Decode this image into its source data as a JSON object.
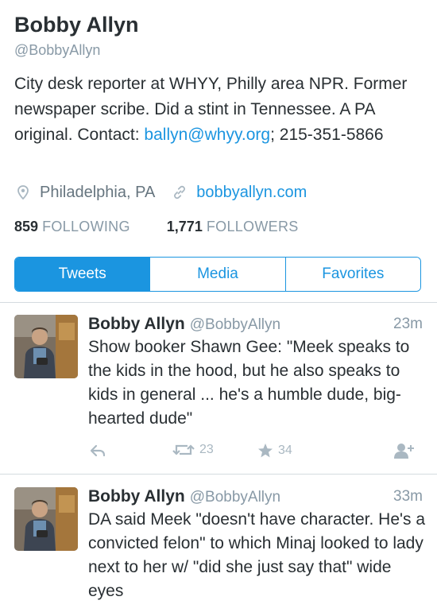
{
  "profile": {
    "name": "Bobby Allyn",
    "handle": "@BobbyAllyn",
    "bio_text": "City desk reporter at WHYY, Philly area NPR. Former newspaper scribe. Did a stint in Tennessee. A PA original. Contact: ",
    "bio_email": "ballyn@whyy.org",
    "bio_phone": "; 215-351-5866",
    "location": "Philadelphia, PA",
    "website": "bobbyallyn.com",
    "following_count": "859",
    "following_label": "FOLLOWING",
    "followers_count": "1,771",
    "followers_label": "FOLLOWERS"
  },
  "tabs": [
    {
      "label": "Tweets",
      "active": true
    },
    {
      "label": "Media",
      "active": false
    },
    {
      "label": "Favorites",
      "active": false
    }
  ],
  "tweets": [
    {
      "name": "Bobby Allyn",
      "handle": "@BobbyAllyn",
      "time": "23m",
      "text": "Show booker Shawn Gee: \"Meek speaks to the kids in the hood, but he also speaks to kids in general ... he's a humble dude, big-hearted dude\"",
      "retweets": "23",
      "favorites": "34"
    },
    {
      "name": "Bobby Allyn",
      "handle": "@BobbyAllyn",
      "time": "33m",
      "text": "DA said Meek \"doesn't have character. He's a convicted felon\" to which Minaj looked to lady next to her w/ \"did she just say that\" wide eyes",
      "retweets": "",
      "favorites": ""
    }
  ],
  "icons": {
    "location": "location-pin-icon",
    "link": "link-icon",
    "reply": "reply-icon",
    "retweet": "retweet-icon",
    "favorite": "star-icon",
    "follow": "follow-user-icon"
  },
  "colors": {
    "accent": "#1b95e0",
    "text": "#292f33",
    "muted": "#8899a6",
    "action": "#aab8c2"
  }
}
